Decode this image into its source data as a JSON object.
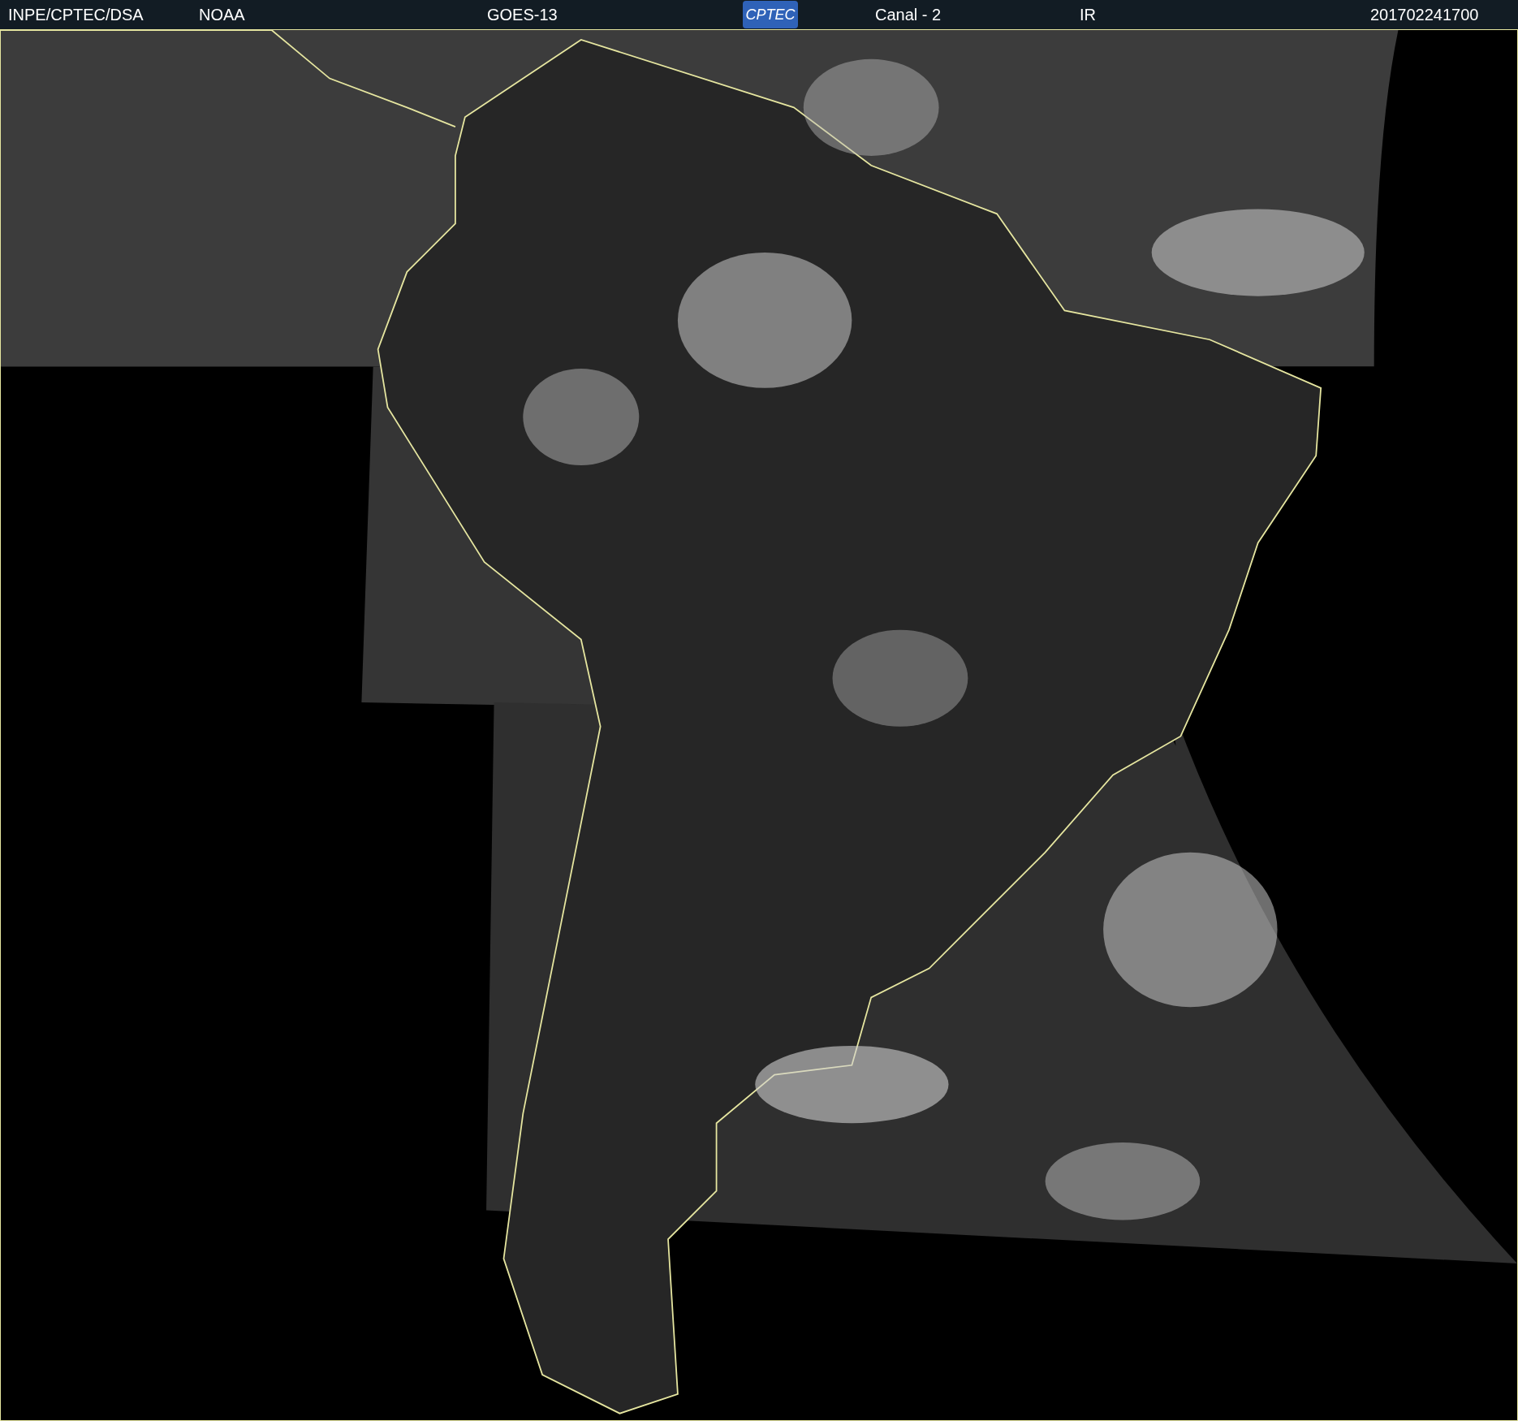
{
  "header": {
    "source": "INPE/CPTEC/DSA",
    "agency": "NOAA",
    "satellite": "GOES-13",
    "logo": "CPTEC",
    "channel": "Canal - 2",
    "band": "IR",
    "timestamp": "201702241700"
  }
}
